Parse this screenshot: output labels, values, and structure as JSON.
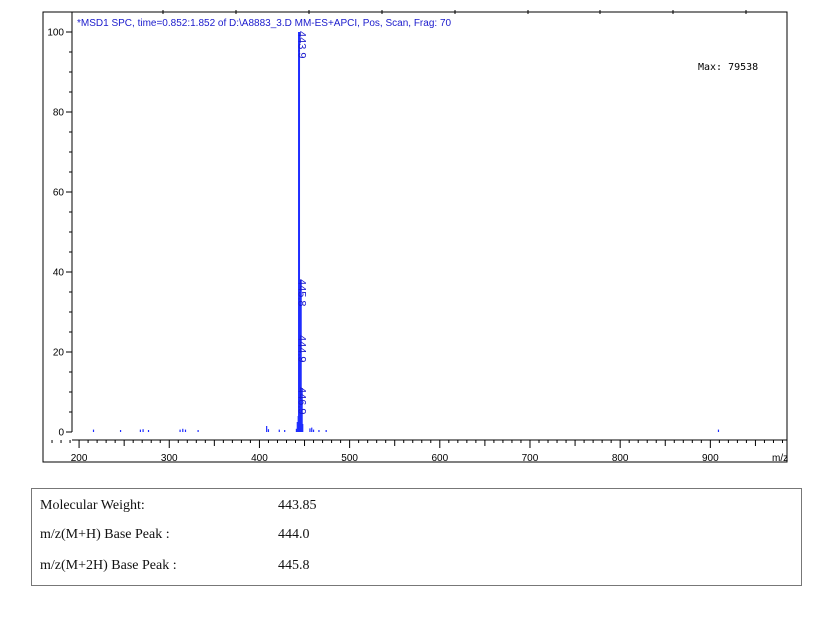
{
  "spectrum_header": "*MSD1 SPC, time=0.852:1.852 of D:\\A8883_3.D    MM-ES+APCI, Pos, Scan, Frag: 70",
  "max_label": "Max:  79538",
  "chart_data": {
    "type": "bar",
    "title": "",
    "xlabel": "m/z",
    "ylabel": "",
    "xlim": [
      160,
      985
    ],
    "ylim": [
      -2,
      105
    ],
    "x_ticks": [
      200,
      300,
      400,
      500,
      600,
      700,
      800,
      900
    ],
    "y_ticks": [
      0,
      20,
      40,
      60,
      80,
      100
    ],
    "series": [
      {
        "x": [
          216,
          246,
          268,
          271,
          277,
          312,
          315,
          318,
          332,
          408,
          410,
          422,
          428,
          441,
          442,
          443,
          443.9,
          444.9,
          445.8,
          446.9,
          448,
          456,
          458,
          460,
          466,
          474,
          909
        ],
        "values": [
          0.6,
          0.5,
          0.6,
          0.7,
          0.5,
          0.6,
          0.8,
          0.6,
          0.5,
          1.5,
          0.7,
          0.6,
          0.5,
          0.8,
          2.5,
          4,
          100,
          24,
          38,
          11,
          2,
          0.9,
          1.1,
          0.6,
          0.5,
          0.5,
          0.6
        ]
      }
    ],
    "peak_labels": [
      {
        "x": 443.9,
        "y": 100,
        "text": "443.9"
      },
      {
        "x": 445.8,
        "y": 38,
        "text": "445.8"
      },
      {
        "x": 444.9,
        "y": 24,
        "text": "444.9"
      },
      {
        "x": 446.9,
        "y": 11,
        "text": "446.9"
      }
    ]
  },
  "info": {
    "rows": [
      {
        "label": "Molecular Weight:",
        "value": "443.85"
      },
      {
        "label": "m/z(M+H) Base Peak :",
        "value": "444.0"
      },
      {
        "label": "m/z(M+2H) Base Peak :",
        "value": "445.8"
      }
    ]
  }
}
